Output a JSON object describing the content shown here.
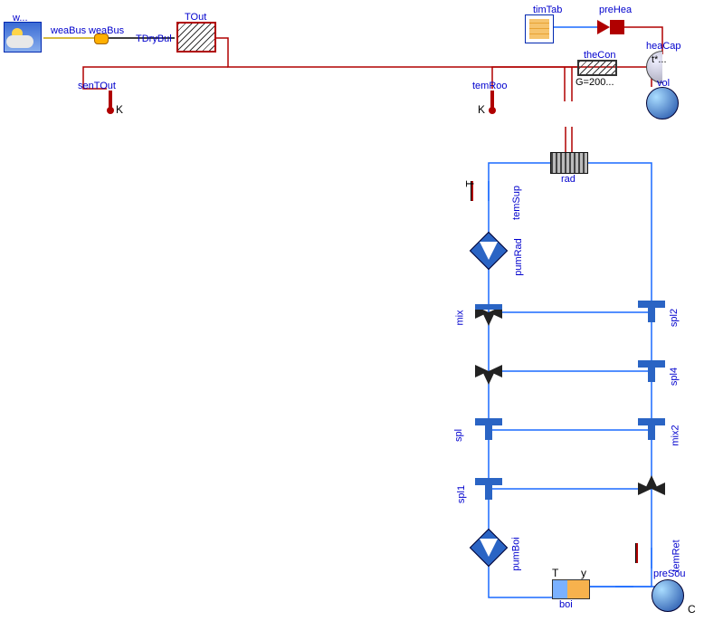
{
  "labels": {
    "w": "w...",
    "weaBus1": "weaBus",
    "weaBus2": "weaBus",
    "TDryBul": "TDryBul",
    "TOut": "TOut",
    "senTOut": "senTOut",
    "timTab": "timTab",
    "preHea": "preHea",
    "heaCap": "heaCap",
    "theCon": "theCon",
    "G": "G=200...",
    "tstar": "t*...",
    "temRoo": "temRoo",
    "vol": "vol",
    "rad": "rad",
    "temSup": "temSup",
    "pumRad": "pumRad",
    "pumBoi": "pumBoi",
    "mix": "mix",
    "mix2": "mix2",
    "spl": "spl",
    "spl1": "spl1",
    "spl2": "spl2",
    "spl4": "spl4",
    "boi": "boi",
    "temRet": "temRet",
    "preSou": "preSou",
    "y": "y",
    "T": "T",
    "K": "K",
    "C": "C"
  }
}
